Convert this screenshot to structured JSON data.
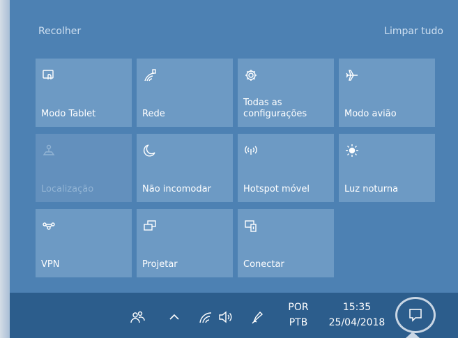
{
  "header": {
    "collapse_label": "Recolher",
    "clear_all_label": "Limpar tudo"
  },
  "tiles": [
    {
      "label": "Modo Tablet",
      "icon": "tablet-mode-icon",
      "state": "enabled"
    },
    {
      "label": "Rede",
      "icon": "network-icon",
      "state": "enabled"
    },
    {
      "label": "Todas as\nconfigurações",
      "icon": "gear-icon",
      "state": "enabled"
    },
    {
      "label": "Modo avião",
      "icon": "airplane-icon",
      "state": "enabled"
    },
    {
      "label": "Localização",
      "icon": "location-icon",
      "state": "disabled"
    },
    {
      "label": "Não incomodar",
      "icon": "moon-icon",
      "state": "enabled"
    },
    {
      "label": "Hotspot móvel",
      "icon": "hotspot-icon",
      "state": "enabled"
    },
    {
      "label": "Luz noturna",
      "icon": "brightness-icon",
      "state": "enabled"
    },
    {
      "label": "VPN",
      "icon": "vpn-icon",
      "state": "enabled"
    },
    {
      "label": "Projetar",
      "icon": "project-icon",
      "state": "enabled"
    },
    {
      "label": "Conectar",
      "icon": "connect-icon",
      "state": "enabled"
    }
  ],
  "taskbar": {
    "language_line1": "POR",
    "language_line2": "PTB",
    "time": "15:35",
    "date": "25/04/2018",
    "icons": [
      "people-icon",
      "chevron-up-icon",
      "wifi-icon",
      "volume-icon",
      "pen-icon",
      "notification-icon"
    ]
  },
  "colors": {
    "panel": "#4d81b3",
    "tile": "#6d9ac4",
    "taskbar": "#2c5d8c"
  }
}
